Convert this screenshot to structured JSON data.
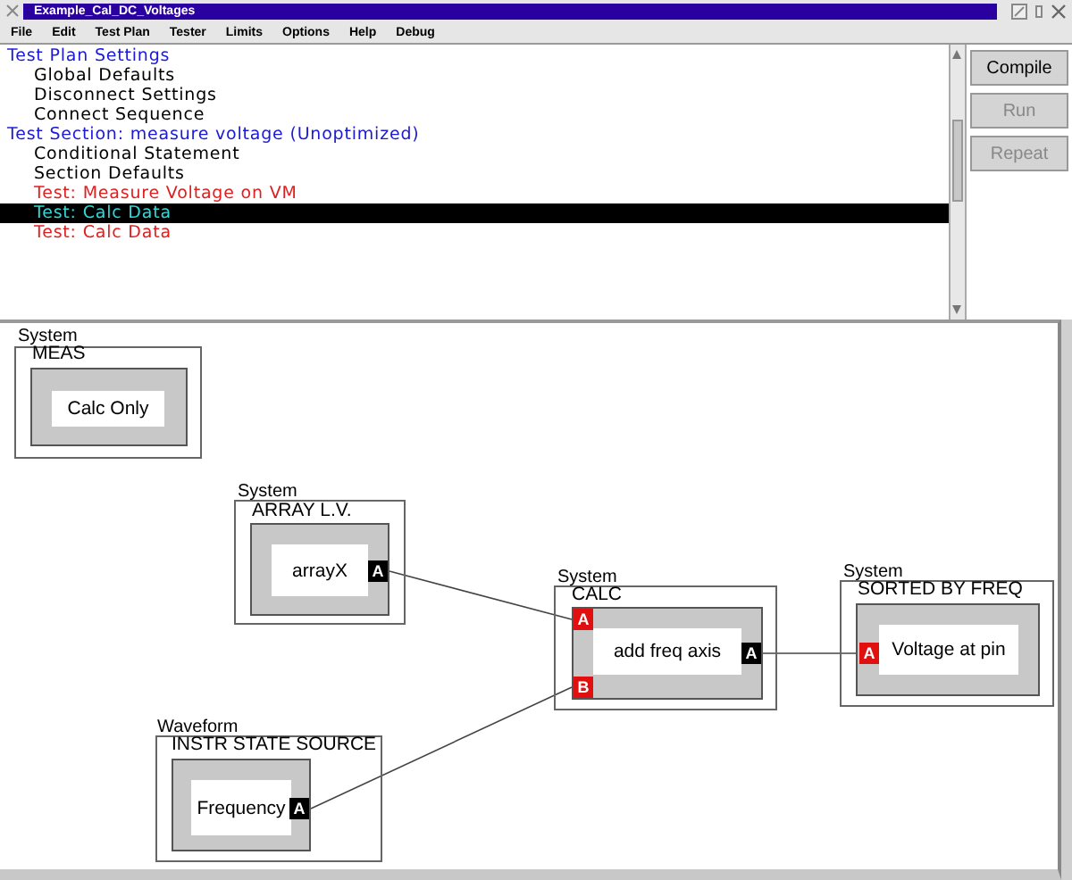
{
  "window": {
    "title": "Example_Cal_DC_Voltages"
  },
  "menu": [
    "File",
    "Edit",
    "Test Plan",
    "Tester",
    "Limits",
    "Options",
    "Help",
    "Debug"
  ],
  "tree": [
    {
      "label": "Test Plan Settings",
      "kind": "heading",
      "selected": false,
      "children": [
        {
          "label": "Global Defaults",
          "kind": "setting",
          "selected": false
        },
        {
          "label": "Disconnect Settings",
          "kind": "setting",
          "selected": false
        },
        {
          "label": "Connect Sequence",
          "kind": "setting",
          "selected": false
        }
      ]
    },
    {
      "label": "Test Section: measure voltage (Unoptimized)",
      "kind": "heading",
      "selected": false,
      "children": [
        {
          "label": "Conditional Statement",
          "kind": "setting",
          "selected": false
        },
        {
          "label": "Section Defaults",
          "kind": "setting",
          "selected": false
        },
        {
          "label": "Test: Measure Voltage on VM",
          "kind": "test",
          "selected": false
        },
        {
          "label": "Test: Calc Data",
          "kind": "test",
          "selected": true
        },
        {
          "label": "Test: Calc Data",
          "kind": "test",
          "selected": false
        }
      ]
    }
  ],
  "buttons": [
    {
      "label": "Compile",
      "disabled": false
    },
    {
      "label": "Run",
      "disabled": true
    },
    {
      "label": "Repeat",
      "disabled": true
    }
  ],
  "diagram": {
    "nodes": [
      {
        "category": "System",
        "title": "MEAS",
        "label": "Calc Only"
      },
      {
        "category": "System",
        "title": "ARRAY L.V.",
        "label": "arrayX",
        "ports": [
          {
            "name": "A",
            "kind": "output"
          }
        ]
      },
      {
        "category": "System",
        "title": "CALC",
        "label": "add freq axis",
        "ports": [
          {
            "name": "A",
            "kind": "input"
          },
          {
            "name": "B",
            "kind": "input"
          },
          {
            "name": "A",
            "kind": "output"
          }
        ]
      },
      {
        "category": "System",
        "title": "SORTED BY FREQ",
        "label": "Voltage at pin",
        "ports": [
          {
            "name": "A",
            "kind": "input"
          }
        ]
      },
      {
        "category": "Waveform",
        "title": "INSTR STATE SOURCE",
        "label": "Frequency",
        "ports": [
          {
            "name": "A",
            "kind": "output"
          }
        ]
      }
    ]
  }
}
